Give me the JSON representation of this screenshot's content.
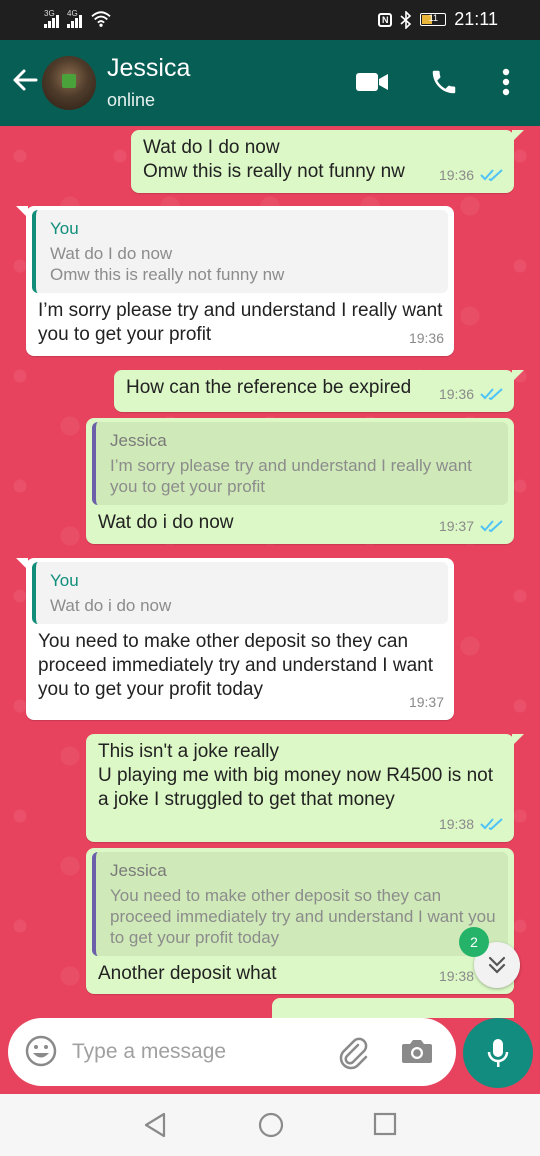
{
  "status_bar": {
    "signal1_label": "3G",
    "signal2_label": "4G",
    "battery_level": "11",
    "time": "21:11",
    "nfc_label": "N"
  },
  "header": {
    "contact_name": "Jessica",
    "contact_status": "online",
    "icons": [
      "back-arrow-icon",
      "video-call-icon",
      "phone-icon",
      "more-options-icon"
    ]
  },
  "messages": [
    {
      "direction": "out",
      "text": "Wat do I do now\nOmw this is really not funny nw",
      "time": "19:36",
      "read": true
    },
    {
      "direction": "in",
      "quote_author": "You",
      "quote_text": "Wat do I do now\nOmw this is really not funny nw",
      "text": "I’m sorry please try and understand I really want you to get your profit",
      "time": "19:36"
    },
    {
      "direction": "out",
      "text": "How can the reference be expired",
      "time": "19:36",
      "read": true
    },
    {
      "direction": "out",
      "quote_author": "Jessica",
      "quote_text": "I’m sorry please try and understand I really want you to get your profit",
      "text": "Wat do i do now",
      "time": "19:37",
      "read": true
    },
    {
      "direction": "in",
      "quote_author": "You",
      "quote_text": "Wat do i do now",
      "text": "You need to make other deposit so they can proceed immediately try and understand I want you to get your profit today",
      "time": "19:37"
    },
    {
      "direction": "out",
      "text": "This isn't a joke really\nU playing me with big money now R4500 is not a joke I struggled to get that money",
      "time": "19:38",
      "read": true
    },
    {
      "direction": "out",
      "quote_author": "Jessica",
      "quote_text": "You need to make other deposit so they can proceed immediately try and understand I want you to get your profit today",
      "text": "Another deposit what",
      "time": "19:38",
      "read": true
    }
  ],
  "unread_count": "2",
  "composer": {
    "placeholder": "Type a message"
  },
  "colors": {
    "header": "#075e54",
    "chat_background": "#e8435e",
    "outgoing_bubble": "#dcf8c6",
    "incoming_bubble": "#ffffff",
    "read_ticks": "#4fc3f7",
    "mic_button": "#128c7e"
  }
}
